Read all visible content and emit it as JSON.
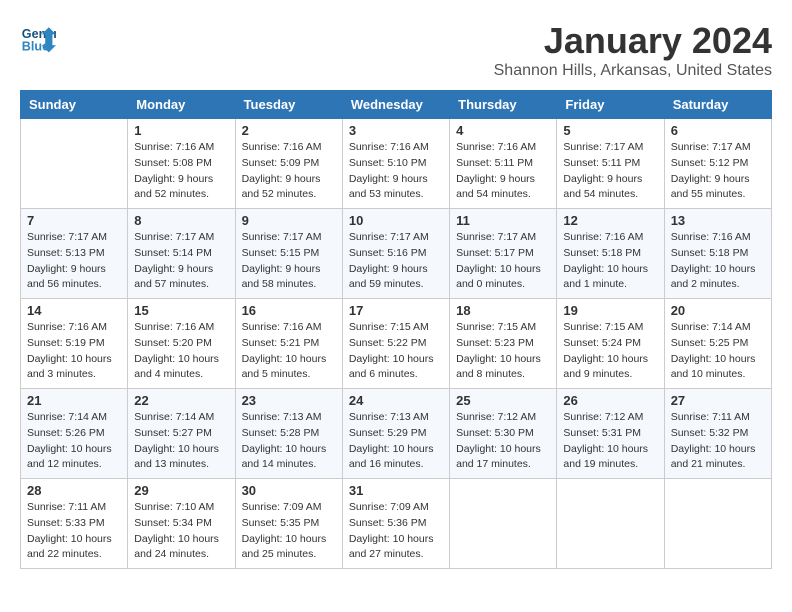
{
  "logo": {
    "line1": "General",
    "line2": "Blue"
  },
  "title": "January 2024",
  "location": "Shannon Hills, Arkansas, United States",
  "days_header": [
    "Sunday",
    "Monday",
    "Tuesday",
    "Wednesday",
    "Thursday",
    "Friday",
    "Saturday"
  ],
  "weeks": [
    [
      {
        "day": "",
        "info": ""
      },
      {
        "day": "1",
        "info": "Sunrise: 7:16 AM\nSunset: 5:08 PM\nDaylight: 9 hours\nand 52 minutes."
      },
      {
        "day": "2",
        "info": "Sunrise: 7:16 AM\nSunset: 5:09 PM\nDaylight: 9 hours\nand 52 minutes."
      },
      {
        "day": "3",
        "info": "Sunrise: 7:16 AM\nSunset: 5:10 PM\nDaylight: 9 hours\nand 53 minutes."
      },
      {
        "day": "4",
        "info": "Sunrise: 7:16 AM\nSunset: 5:11 PM\nDaylight: 9 hours\nand 54 minutes."
      },
      {
        "day": "5",
        "info": "Sunrise: 7:17 AM\nSunset: 5:11 PM\nDaylight: 9 hours\nand 54 minutes."
      },
      {
        "day": "6",
        "info": "Sunrise: 7:17 AM\nSunset: 5:12 PM\nDaylight: 9 hours\nand 55 minutes."
      }
    ],
    [
      {
        "day": "7",
        "info": "Sunrise: 7:17 AM\nSunset: 5:13 PM\nDaylight: 9 hours\nand 56 minutes."
      },
      {
        "day": "8",
        "info": "Sunrise: 7:17 AM\nSunset: 5:14 PM\nDaylight: 9 hours\nand 57 minutes."
      },
      {
        "day": "9",
        "info": "Sunrise: 7:17 AM\nSunset: 5:15 PM\nDaylight: 9 hours\nand 58 minutes."
      },
      {
        "day": "10",
        "info": "Sunrise: 7:17 AM\nSunset: 5:16 PM\nDaylight: 9 hours\nand 59 minutes."
      },
      {
        "day": "11",
        "info": "Sunrise: 7:17 AM\nSunset: 5:17 PM\nDaylight: 10 hours\nand 0 minutes."
      },
      {
        "day": "12",
        "info": "Sunrise: 7:16 AM\nSunset: 5:18 PM\nDaylight: 10 hours\nand 1 minute."
      },
      {
        "day": "13",
        "info": "Sunrise: 7:16 AM\nSunset: 5:18 PM\nDaylight: 10 hours\nand 2 minutes."
      }
    ],
    [
      {
        "day": "14",
        "info": "Sunrise: 7:16 AM\nSunset: 5:19 PM\nDaylight: 10 hours\nand 3 minutes."
      },
      {
        "day": "15",
        "info": "Sunrise: 7:16 AM\nSunset: 5:20 PM\nDaylight: 10 hours\nand 4 minutes."
      },
      {
        "day": "16",
        "info": "Sunrise: 7:16 AM\nSunset: 5:21 PM\nDaylight: 10 hours\nand 5 minutes."
      },
      {
        "day": "17",
        "info": "Sunrise: 7:15 AM\nSunset: 5:22 PM\nDaylight: 10 hours\nand 6 minutes."
      },
      {
        "day": "18",
        "info": "Sunrise: 7:15 AM\nSunset: 5:23 PM\nDaylight: 10 hours\nand 8 minutes."
      },
      {
        "day": "19",
        "info": "Sunrise: 7:15 AM\nSunset: 5:24 PM\nDaylight: 10 hours\nand 9 minutes."
      },
      {
        "day": "20",
        "info": "Sunrise: 7:14 AM\nSunset: 5:25 PM\nDaylight: 10 hours\nand 10 minutes."
      }
    ],
    [
      {
        "day": "21",
        "info": "Sunrise: 7:14 AM\nSunset: 5:26 PM\nDaylight: 10 hours\nand 12 minutes."
      },
      {
        "day": "22",
        "info": "Sunrise: 7:14 AM\nSunset: 5:27 PM\nDaylight: 10 hours\nand 13 minutes."
      },
      {
        "day": "23",
        "info": "Sunrise: 7:13 AM\nSunset: 5:28 PM\nDaylight: 10 hours\nand 14 minutes."
      },
      {
        "day": "24",
        "info": "Sunrise: 7:13 AM\nSunset: 5:29 PM\nDaylight: 10 hours\nand 16 minutes."
      },
      {
        "day": "25",
        "info": "Sunrise: 7:12 AM\nSunset: 5:30 PM\nDaylight: 10 hours\nand 17 minutes."
      },
      {
        "day": "26",
        "info": "Sunrise: 7:12 AM\nSunset: 5:31 PM\nDaylight: 10 hours\nand 19 minutes."
      },
      {
        "day": "27",
        "info": "Sunrise: 7:11 AM\nSunset: 5:32 PM\nDaylight: 10 hours\nand 21 minutes."
      }
    ],
    [
      {
        "day": "28",
        "info": "Sunrise: 7:11 AM\nSunset: 5:33 PM\nDaylight: 10 hours\nand 22 minutes."
      },
      {
        "day": "29",
        "info": "Sunrise: 7:10 AM\nSunset: 5:34 PM\nDaylight: 10 hours\nand 24 minutes."
      },
      {
        "day": "30",
        "info": "Sunrise: 7:09 AM\nSunset: 5:35 PM\nDaylight: 10 hours\nand 25 minutes."
      },
      {
        "day": "31",
        "info": "Sunrise: 7:09 AM\nSunset: 5:36 PM\nDaylight: 10 hours\nand 27 minutes."
      },
      {
        "day": "",
        "info": ""
      },
      {
        "day": "",
        "info": ""
      },
      {
        "day": "",
        "info": ""
      }
    ]
  ]
}
